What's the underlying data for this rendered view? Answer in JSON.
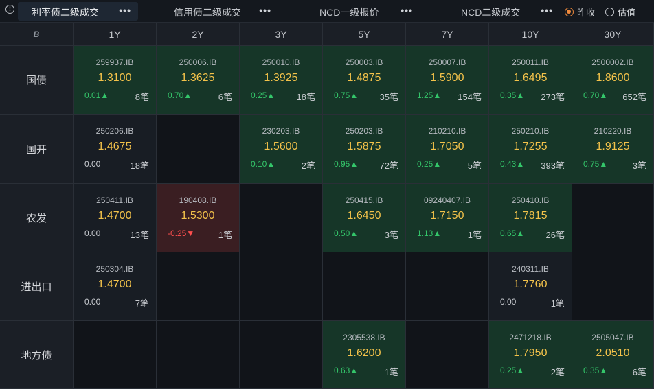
{
  "tabs": [
    {
      "label": "利率债二级成交",
      "more": "•••"
    },
    {
      "label": "信用债二级成交",
      "more": "•••"
    },
    {
      "label": "NCD一级报价",
      "more": "•••"
    },
    {
      "label": "NCD二级成交",
      "more": "•••"
    }
  ],
  "mode_options": [
    {
      "label": "昨收",
      "selected": true
    },
    {
      "label": "估值",
      "selected": false
    }
  ],
  "corner_logo": "B",
  "columns": [
    "1Y",
    "2Y",
    "3Y",
    "5Y",
    "7Y",
    "10Y",
    "30Y"
  ],
  "rows": [
    {
      "label": "国债",
      "cells": [
        {
          "code": "259937.IB",
          "yield": "1.3100",
          "change": "0.01▲",
          "count": "8笔",
          "dir": "pos"
        },
        {
          "code": "250006.IB",
          "yield": "1.3625",
          "change": "0.70▲",
          "count": "6笔",
          "dir": "pos"
        },
        {
          "code": "250010.IB",
          "yield": "1.3925",
          "change": "0.25▲",
          "count": "18笔",
          "dir": "pos"
        },
        {
          "code": "250003.IB",
          "yield": "1.4875",
          "change": "0.75▲",
          "count": "35笔",
          "dir": "pos"
        },
        {
          "code": "250007.IB",
          "yield": "1.5900",
          "change": "1.25▲",
          "count": "154笔",
          "dir": "pos"
        },
        {
          "code": "250011.IB",
          "yield": "1.6495",
          "change": "0.35▲",
          "count": "273笔",
          "dir": "pos"
        },
        {
          "code": "2500002.IB",
          "yield": "1.8600",
          "change": "0.70▲",
          "count": "652笔",
          "dir": "pos"
        }
      ]
    },
    {
      "label": "国开",
      "cells": [
        {
          "code": "250206.IB",
          "yield": "1.4675",
          "change": "0.00",
          "count": "18笔",
          "dir": "zero"
        },
        null,
        {
          "code": "230203.IB",
          "yield": "1.5600",
          "change": "0.10▲",
          "count": "2笔",
          "dir": "pos"
        },
        {
          "code": "250203.IB",
          "yield": "1.5875",
          "change": "0.95▲",
          "count": "72笔",
          "dir": "pos"
        },
        {
          "code": "210210.IB",
          "yield": "1.7050",
          "change": "0.25▲",
          "count": "5笔",
          "dir": "pos"
        },
        {
          "code": "250210.IB",
          "yield": "1.7255",
          "change": "0.43▲",
          "count": "393笔",
          "dir": "pos"
        },
        {
          "code": "210220.IB",
          "yield": "1.9125",
          "change": "0.75▲",
          "count": "3笔",
          "dir": "pos"
        }
      ]
    },
    {
      "label": "农发",
      "cells": [
        {
          "code": "250411.IB",
          "yield": "1.4700",
          "change": "0.00",
          "count": "13笔",
          "dir": "zero"
        },
        {
          "code": "190408.IB",
          "yield": "1.5300",
          "change": "-0.25▼",
          "count": "1笔",
          "dir": "neg"
        },
        null,
        {
          "code": "250415.IB",
          "yield": "1.6450",
          "change": "0.50▲",
          "count": "3笔",
          "dir": "pos"
        },
        {
          "code": "09240407.IB",
          "yield": "1.7150",
          "change": "1.13▲",
          "count": "1笔",
          "dir": "pos"
        },
        {
          "code": "250410.IB",
          "yield": "1.7815",
          "change": "0.65▲",
          "count": "26笔",
          "dir": "pos"
        },
        null
      ]
    },
    {
      "label": "进出口",
      "cells": [
        {
          "code": "250304.IB",
          "yield": "1.4700",
          "change": "0.00",
          "count": "7笔",
          "dir": "zero"
        },
        null,
        null,
        null,
        null,
        {
          "code": "240311.IB",
          "yield": "1.7760",
          "change": "0.00",
          "count": "1笔",
          "dir": "zero"
        },
        null
      ]
    },
    {
      "label": "地方债",
      "cells": [
        null,
        null,
        null,
        {
          "code": "2305538.IB",
          "yield": "1.6200",
          "change": "0.63▲",
          "count": "1笔",
          "dir": "pos"
        },
        null,
        {
          "code": "2471218.IB",
          "yield": "1.7950",
          "change": "0.25▲",
          "count": "2笔",
          "dir": "pos"
        },
        {
          "code": "2505047.IB",
          "yield": "2.0510",
          "change": "0.35▲",
          "count": "6笔",
          "dir": "pos"
        }
      ]
    }
  ]
}
